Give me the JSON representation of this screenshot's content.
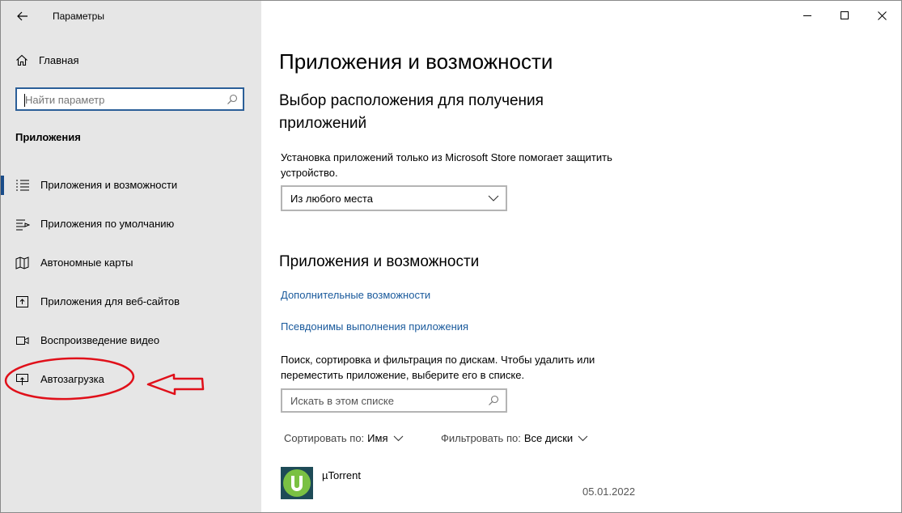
{
  "window": {
    "title": "Параметры"
  },
  "sidebar": {
    "home_label": "Главная",
    "search_placeholder": "Найти параметр",
    "section_title": "Приложения",
    "items": [
      {
        "label": "Приложения и возможности",
        "icon": "list-icon",
        "selected": true
      },
      {
        "label": "Приложения по умолчанию",
        "icon": "default-apps-icon",
        "selected": false
      },
      {
        "label": "Автономные карты",
        "icon": "map-icon",
        "selected": false
      },
      {
        "label": "Приложения для веб-сайтов",
        "icon": "web-apps-icon",
        "selected": false
      },
      {
        "label": "Воспроизведение видео",
        "icon": "video-icon",
        "selected": false
      },
      {
        "label": "Автозагрузка",
        "icon": "startup-icon",
        "selected": false
      }
    ]
  },
  "main": {
    "title": "Приложения и возможности",
    "install_location": {
      "heading_line1": "Выбор расположения для получения",
      "heading_line2": "приложений",
      "description_line1": "Установка приложений только из Microsoft Store помогает защитить",
      "description_line2": "устройство.",
      "selected": "Из любого места"
    },
    "apps_section": {
      "heading": "Приложения и возможности",
      "link_optional": "Дополнительные возможности",
      "link_aliases": "Псевдонимы выполнения приложения",
      "description_line1": "Поиск, сортировка и фильтрация по дискам. Чтобы удалить или",
      "description_line2": "переместить приложение, выберите его в списке.",
      "search_placeholder": "Искать в этом списке",
      "sort_label": "Сортировать по:",
      "sort_value": "Имя",
      "filter_label": "Фильтровать по:",
      "filter_value": "Все диски",
      "apps": [
        {
          "name": "µTorrent",
          "date": "05.01.2022"
        }
      ]
    }
  },
  "colors": {
    "sidebar_bg": "#e6e6e6",
    "accent": "#1a4c89",
    "link": "#1a5a9c",
    "annotation": "#e0101a",
    "utorrent_green": "#7ac143"
  }
}
